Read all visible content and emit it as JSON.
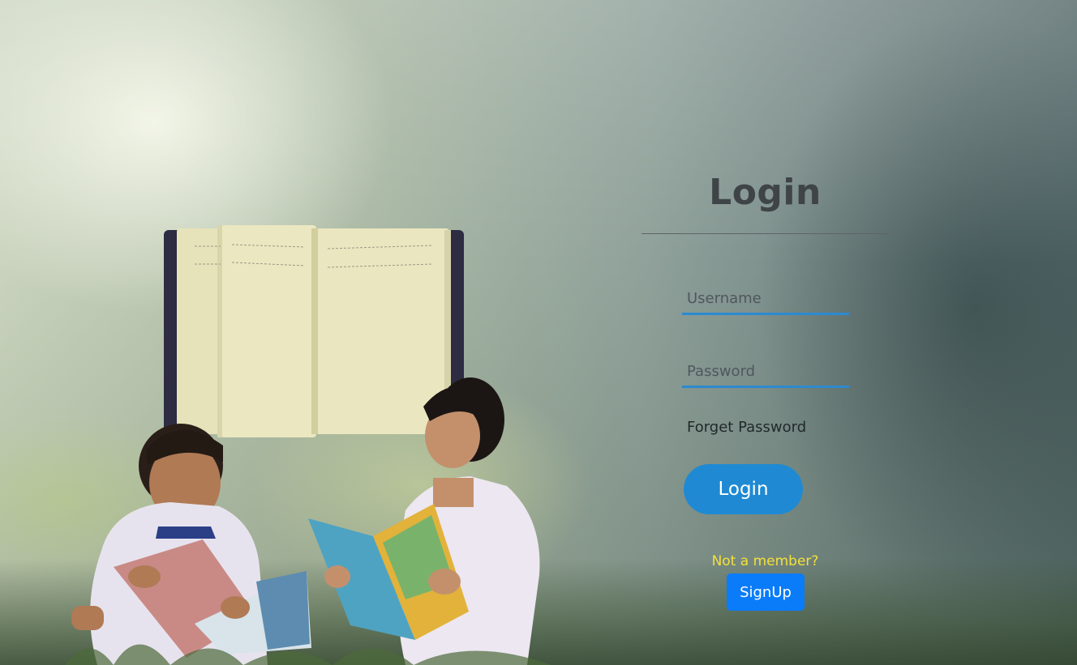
{
  "login": {
    "title": "Login",
    "username_placeholder": "Username",
    "password_placeholder": "Password",
    "forget_password": "Forget Password",
    "login_button": "Login",
    "not_member": "Not a member?",
    "signup_button": "SignUp"
  },
  "colors": {
    "login_button": "#1f8ad3",
    "signup_button": "#0a7cfa",
    "not_member_text": "#f4e03a",
    "field_underline": "#2c8ad0",
    "title": "#3f4447"
  },
  "icons": {
    "book": "open-book-icon",
    "illustration": "kids-reading-illustration"
  }
}
